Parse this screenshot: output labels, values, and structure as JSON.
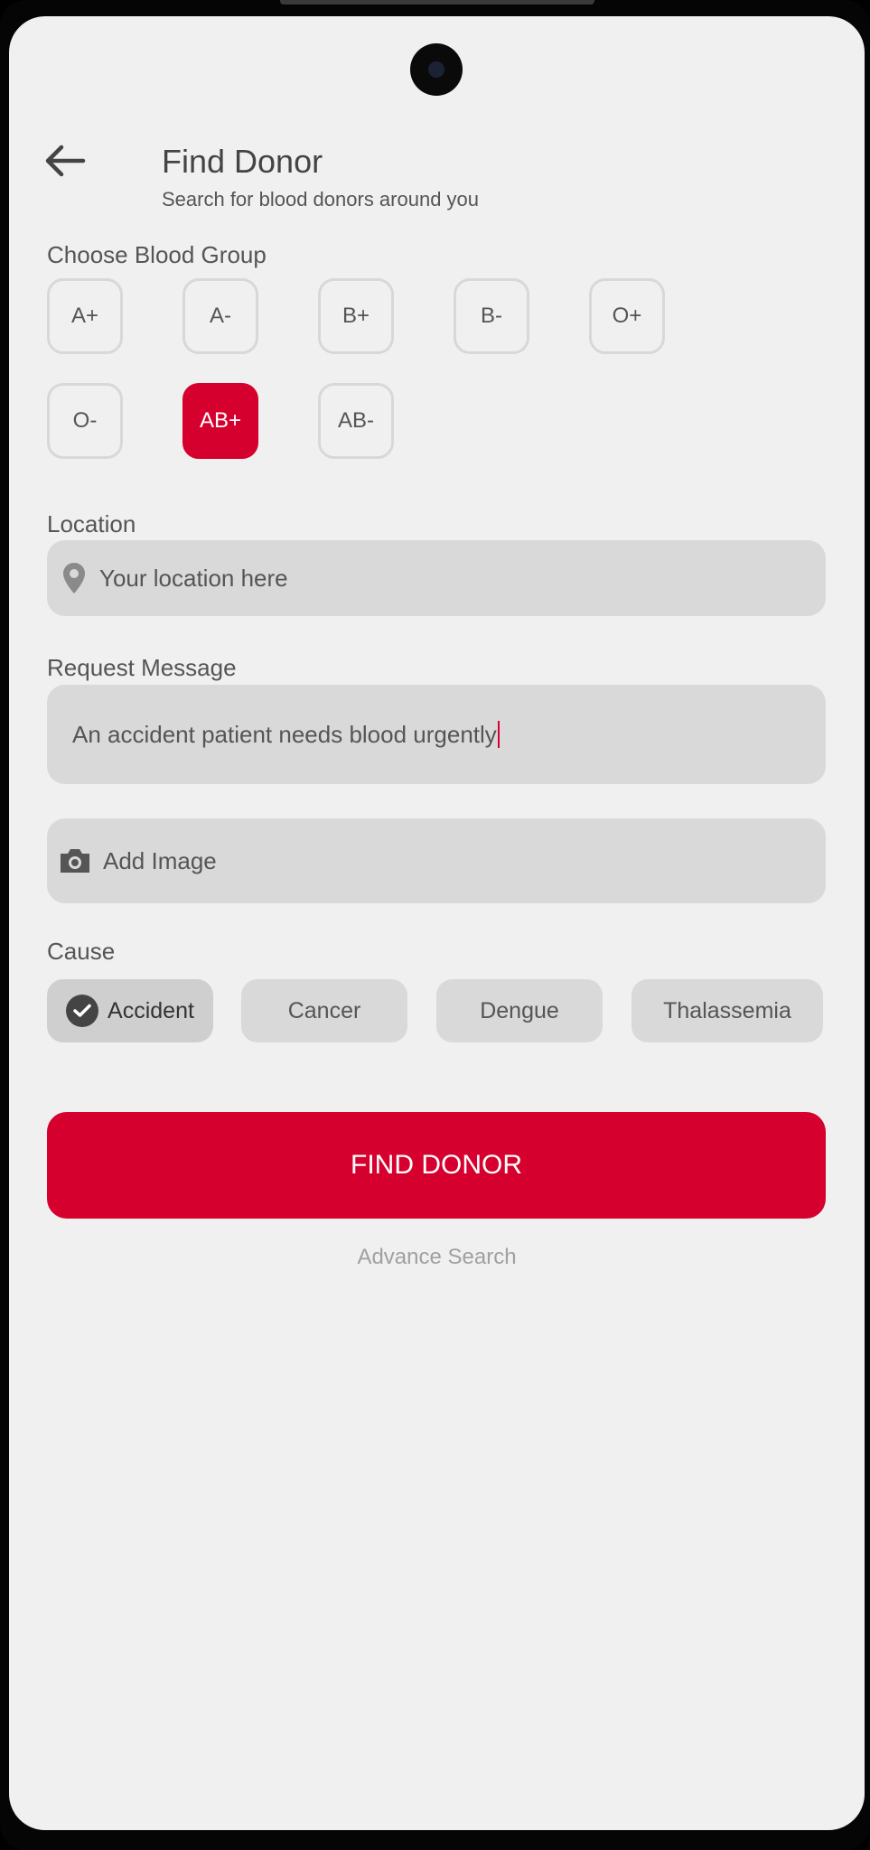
{
  "header": {
    "title": "Find Donor",
    "subtitle": "Search for blood donors around you"
  },
  "blood_group": {
    "label": "Choose Blood Group",
    "options": [
      "A+",
      "A-",
      "B+",
      "B-",
      "O+",
      "O-",
      "AB+",
      "AB-"
    ],
    "selected": "AB+"
  },
  "location": {
    "label": "Location",
    "placeholder": "Your location here",
    "icon": "location-pin-icon"
  },
  "request": {
    "label": "Request Message",
    "value": "An accident patient needs blood urgently"
  },
  "image": {
    "label": "Add Image",
    "icon": "camera-icon"
  },
  "cause": {
    "label": "Cause",
    "options": [
      "Accident",
      "Cancer",
      "Dengue",
      "Thalassemia"
    ],
    "selected": "Accident"
  },
  "actions": {
    "find_label": "FIND DONOR",
    "advance_label": "Advance Search"
  },
  "colors": {
    "accent": "#d6002e",
    "background": "#f0f0f0",
    "field": "#d9d9d9"
  }
}
